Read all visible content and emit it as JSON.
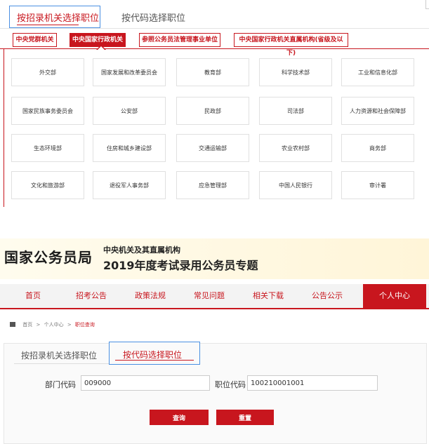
{
  "top_tabs": [
    "按招录机关选择职位",
    "按代码选择职位"
  ],
  "categories": [
    "中央党群机关",
    "中央国家行政机关",
    "参照公务员法管理事业单位",
    "中央国家行政机关直属机构(省级及以下)"
  ],
  "departments": [
    [
      "外交部",
      "国家发展和改革委员会",
      "教育部",
      "科学技术部",
      "工业和信息化部"
    ],
    [
      "国家民族事务委员会",
      "公安部",
      "民政部",
      "司法部",
      "人力资源和社会保障部"
    ],
    [
      "生态环境部",
      "住房和城乡建设部",
      "交通运输部",
      "农业农村部",
      "商务部"
    ],
    [
      "文化和旅游部",
      "退役军人事务部",
      "应急管理部",
      "中国人民银行",
      "审计署"
    ]
  ],
  "banner": {
    "logo": "国家公务员局",
    "subtitle1": "中央机关及其直属机构",
    "subtitle2": "2019年度考试录用公务员专题"
  },
  "nav": [
    "首页",
    "招考公告",
    "政策法规",
    "常见问题",
    "相关下载",
    "公告公示",
    "个人中心"
  ],
  "breadcrumb": {
    "home": "首页",
    "sep1": ">",
    "level1": "个人中心",
    "sep2": ">",
    "current": "职位查询"
  },
  "lower_tabs": [
    "按招录机关选择职位",
    "按代码选择职位"
  ],
  "form": {
    "dept_label": "部门代码",
    "dept_value": "009000",
    "pos_label": "职位代码",
    "pos_value": "100210001001",
    "search_btn": "查询",
    "reset_btn": "重置"
  },
  "colors": {
    "accent": "#c8161e",
    "focus": "#4a90e2"
  }
}
